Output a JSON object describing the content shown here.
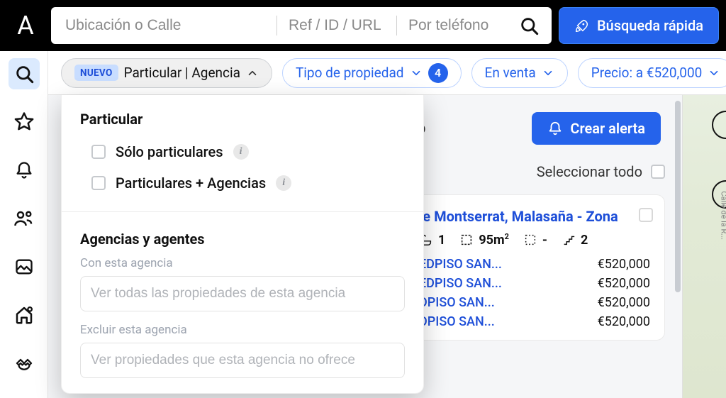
{
  "header": {
    "logo_glyph": "A",
    "search": {
      "location_placeholder": "Ubicación o Calle",
      "ref_placeholder": "Ref / ID / URL",
      "phone_placeholder": "Por teléfono"
    },
    "quick_search_label": "Búsqueda rápida"
  },
  "filters": {
    "particular": {
      "new_badge": "NUEVO",
      "label": "Particular | Agencia"
    },
    "property_type": {
      "label": "Tipo de propiedad",
      "count": "4"
    },
    "status": {
      "label": "En venta"
    },
    "price": {
      "label": "Precio: a €520,000"
    }
  },
  "dropdown": {
    "section_particular_title": "Particular",
    "only_private_label": "Sólo particulares",
    "private_plus_agencies_label": "Particulares + Agencias",
    "section_agencies_title": "Agencias y agentes",
    "with_agency_label": "Con esta agencia",
    "with_agency_placeholder": "Ver todas las propiedades de esta agencia",
    "exclude_agency_label": "Excluir esta agencia",
    "exclude_agency_placeholder": "Ver propiedades que esta agencia no ofrece"
  },
  "results": {
    "partial_word": "o",
    "create_alert": "Crear alerta",
    "select_all": "Seleccionar todo",
    "listing": {
      "title_fragment": "le Montserrat, Malasaña - Zona",
      "specs": {
        "baths": "1",
        "area_value": "95m",
        "area_sup": "2",
        "plot": "-",
        "floors": "2"
      },
      "rows": [
        {
          "agency": "EDPISO SAN...",
          "price": "€520,000"
        },
        {
          "agency": "EDPISO SAN...",
          "price": "€520,000"
        },
        {
          "agency": "DPISO SAN...",
          "price": "€520,000"
        },
        {
          "agency": "DPISO SAN...",
          "price": "€520,000"
        }
      ]
    }
  },
  "map": {
    "road_label": "Calle de la R..."
  }
}
